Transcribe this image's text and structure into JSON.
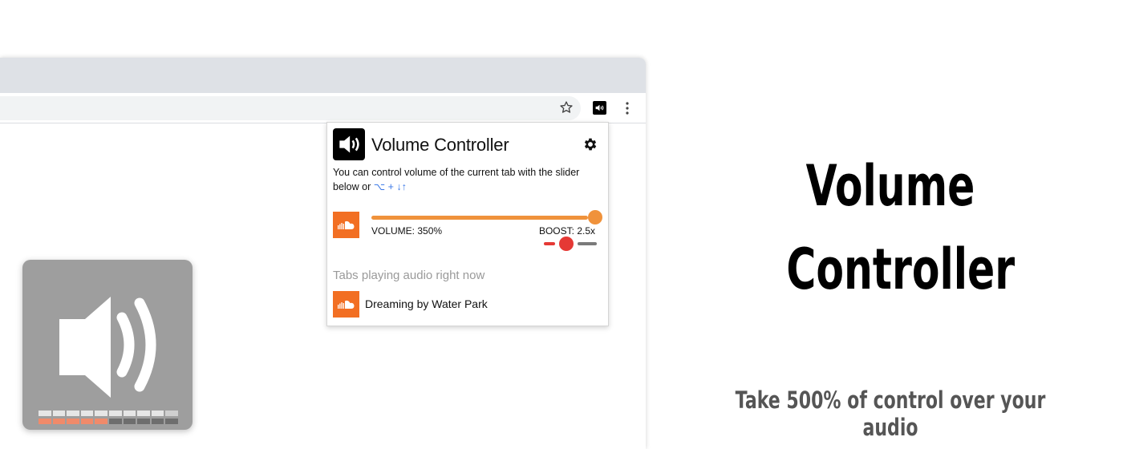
{
  "popup": {
    "title": "Volume Controller",
    "description": "You can control volume of the current tab with the slider below or ",
    "shortcut": "⌥ + ↓↑",
    "volume_label": "VOLUME: 350%",
    "boost_label": "BOOST: 2.5x",
    "volume_fraction": 1.0,
    "boost_fraction": 0.5,
    "playing_heading": "Tabs playing audio right now",
    "playing_tab": "Dreaming by Water Park"
  },
  "hero": {
    "title_line1": "Volume",
    "title_line2": "Controller",
    "tagline": "Take 500% of control over your audio"
  },
  "level_meter": {
    "cells_per_row": 10,
    "top_row_lit": 9,
    "bottom_row_lit": 5
  },
  "colors": {
    "accent": "#f0923b",
    "boost": "#e53935",
    "soundcloud": "#f26f23",
    "icon_bg": "#9e9e9e"
  },
  "icons": [
    "star-icon",
    "volume-extension-icon",
    "more-menu-icon",
    "gear-icon",
    "soundcloud-favicon",
    "speaker-icon"
  ]
}
